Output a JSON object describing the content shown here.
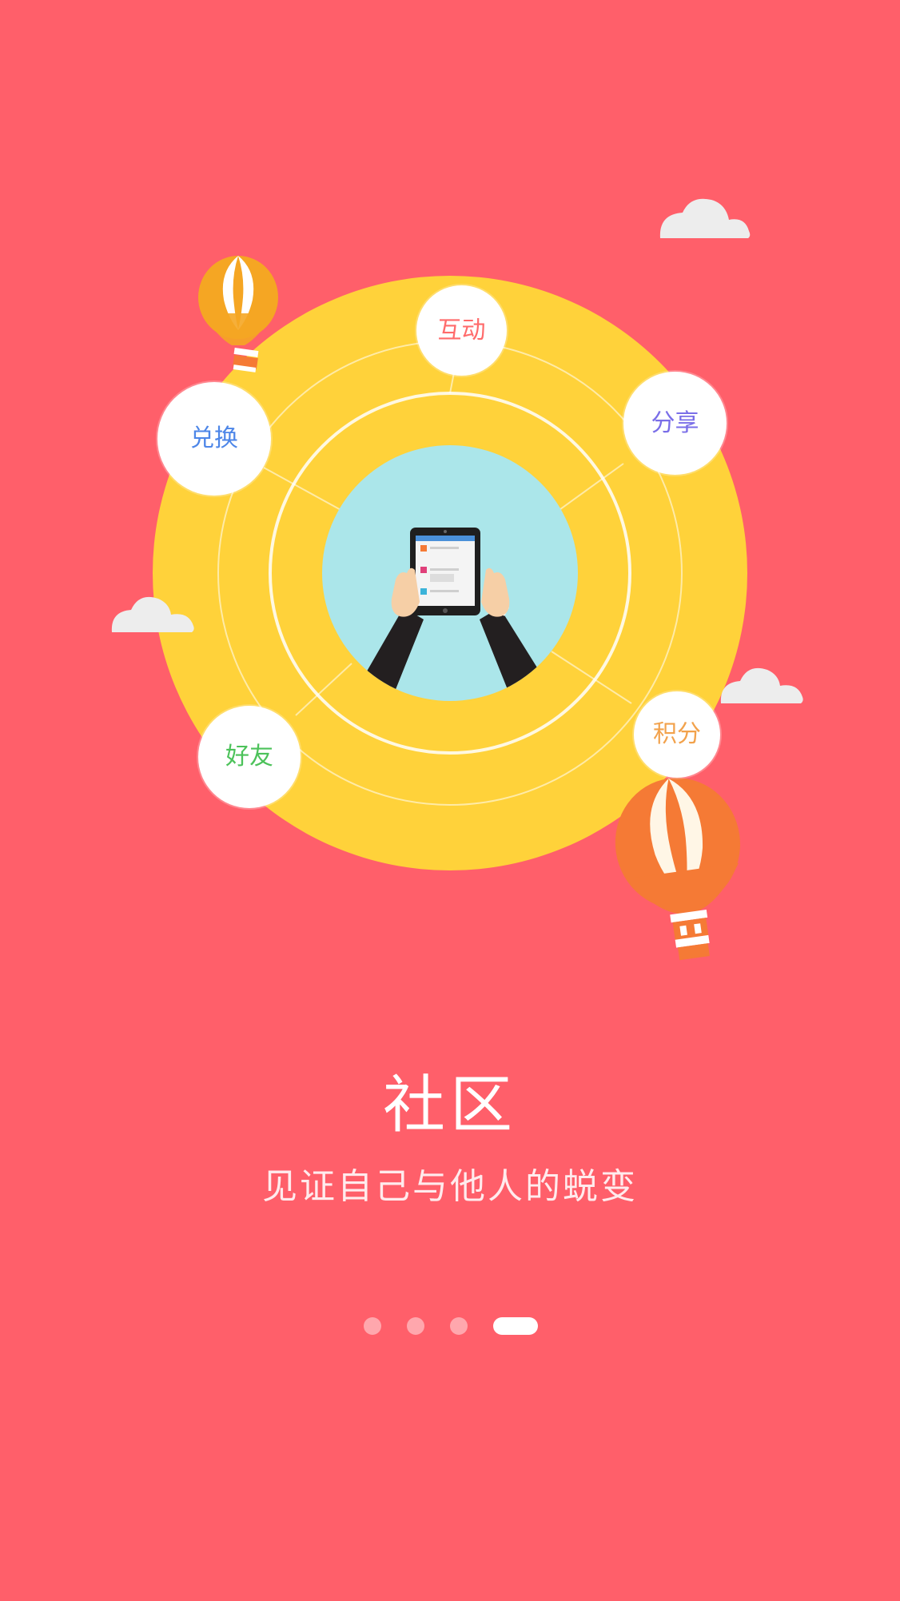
{
  "title": "社区",
  "subtitle": "见证自己与他人的蜕变",
  "features": {
    "hudong": {
      "label": "互动",
      "color": "#ff6b6b"
    },
    "fenxiang": {
      "label": "分享",
      "color": "#7a6ee8"
    },
    "duihuan": {
      "label": "兑换",
      "color": "#4d86e8"
    },
    "haoyou": {
      "label": "好友",
      "color": "#4cc25a"
    },
    "jifen": {
      "label": "积分",
      "color": "#f2a24c"
    }
  },
  "pager": {
    "total": 4,
    "active_index": 3
  },
  "colors": {
    "background": "#ff5f6a",
    "ring": "#ffd23a",
    "center": "#abe6ea",
    "bubble": "#ffffff",
    "cloud": "#eeeeee",
    "balloon_orange": "#f57a35",
    "balloon_yellow": "#f5a623"
  }
}
